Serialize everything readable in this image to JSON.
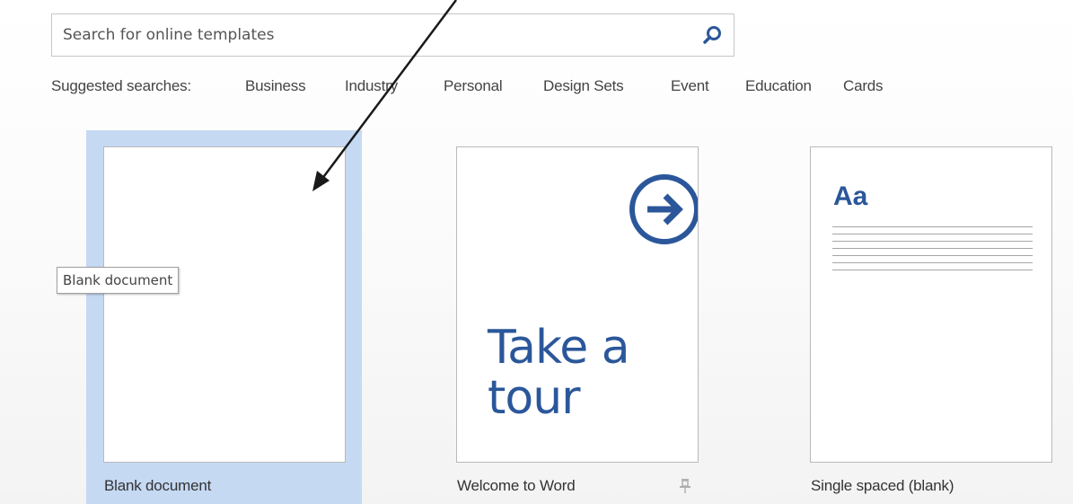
{
  "search": {
    "placeholder": "Search for online templates",
    "icon": "search-icon"
  },
  "suggested": {
    "label": "Suggested searches:",
    "links": [
      "Business",
      "Industry",
      "Personal",
      "Design Sets",
      "Event",
      "Education",
      "Cards"
    ]
  },
  "templates": [
    {
      "caption": "Blank document",
      "selected": true
    },
    {
      "caption": "Welcome to Word",
      "thumb_text": "Take a tour",
      "thumb_icon": "arrow-circle-icon",
      "pinnable": true
    },
    {
      "caption": "Single spaced (blank)",
      "thumb_text": "Aa"
    }
  ],
  "tooltip": "Blank document",
  "colors": {
    "selected_tile": "#c5d9f3",
    "accent": "#2b579a"
  }
}
